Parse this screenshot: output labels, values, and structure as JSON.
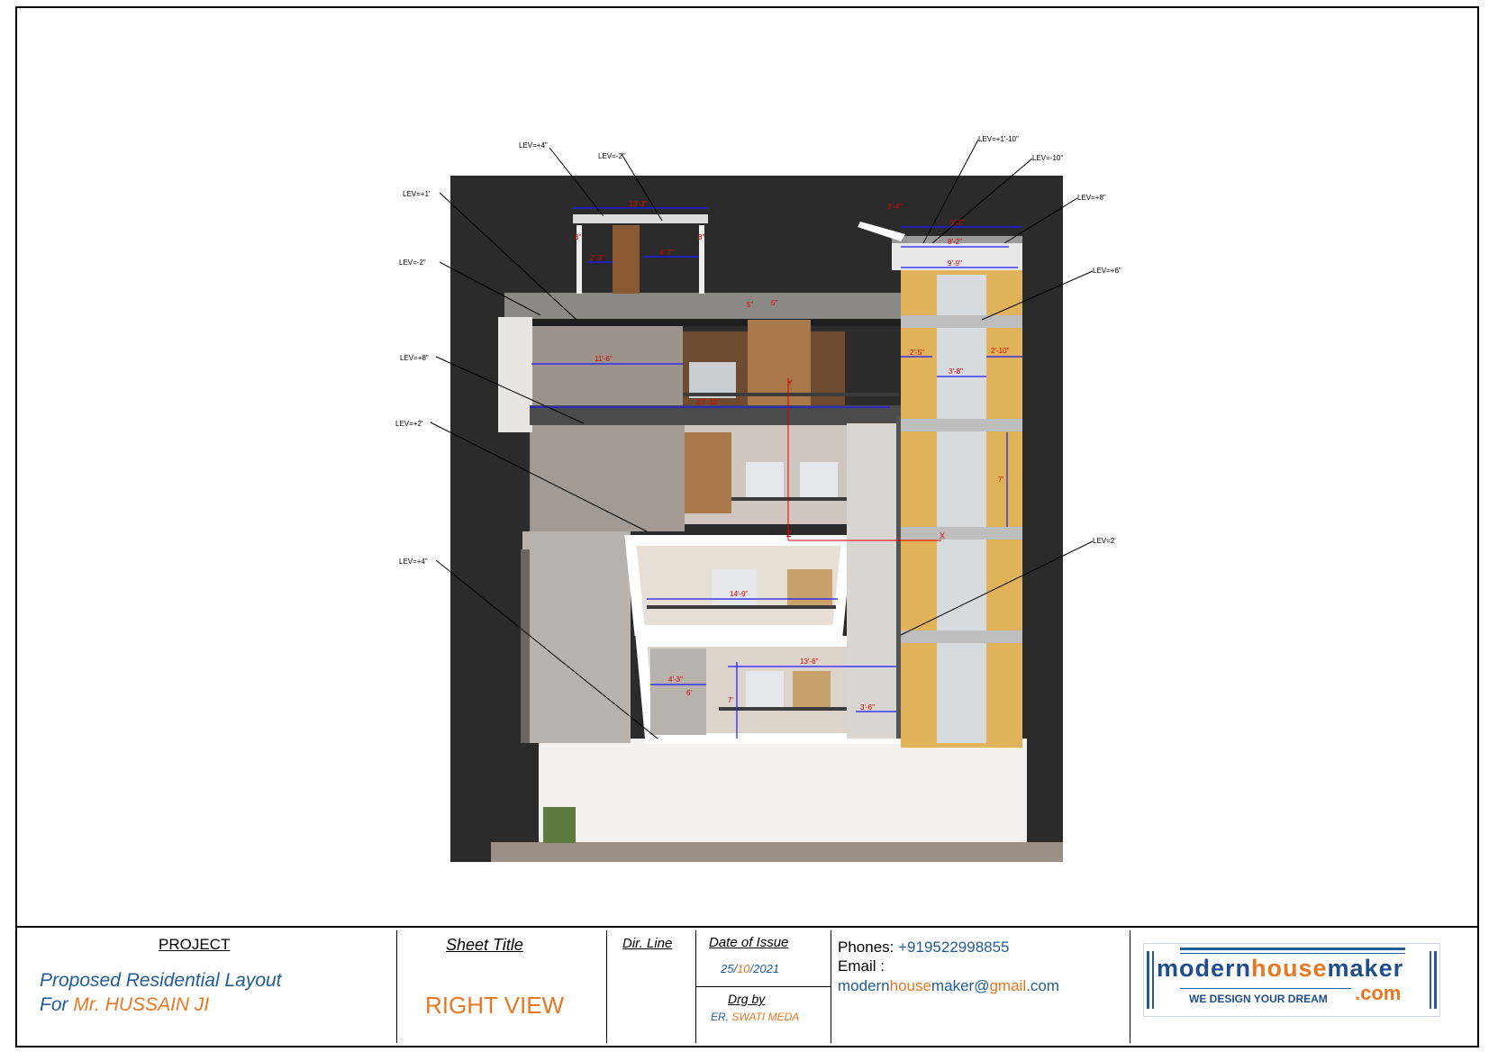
{
  "drawing": {
    "level_labels": [
      "LEV=+4\"",
      "LEV=-2\"",
      "LEV=+1'",
      "LEV=-2\"",
      "LEV=+8\"",
      "LEV=+2'",
      "LEV=+4\"",
      "LEV=+1'-10\"",
      "LEV=-10\"",
      "LEV=+8\"",
      "LEV=+6\"",
      "LEV=2'"
    ],
    "dimension_labels": [
      "10'-3\"",
      "8\"",
      "2'-3\"",
      "4'-7\"",
      "8\"",
      "11'-6\"",
      "27'-10\"",
      "5\"",
      "5\"",
      "3'-4\"",
      "9'-5\"",
      "8'-2\"",
      "9'-9\"",
      "2'-5\"",
      "2'-10\"",
      "3'-8\"",
      "7'",
      "14'-9\"",
      "13'-6\"",
      "4'-3\"",
      "3'-6\"",
      "6'",
      "7'"
    ],
    "axis_labels": [
      "Y",
      "Z",
      "X"
    ],
    "colors": {
      "background": "#2b2b2b",
      "facade": "#c8c0bb",
      "yellow_panel": "#e0b25a",
      "wood": "#8a5a34",
      "stone": "#9c948c",
      "dimension_red": "#e00000",
      "dimension_blue": "#1a1aff"
    }
  },
  "title_block": {
    "project_heading": "PROJECT",
    "project_line1": "Proposed Residential Layout",
    "project_line2_prefix": "For ",
    "project_line2_name": "Mr. HUSSAIN JI",
    "sheet_title_heading": "Sheet Title",
    "sheet_title_value": "RIGHT VIEW",
    "dir_line_heading": "Dir. Line",
    "date_heading": "Date of Issue",
    "date_day": "25/",
    "date_month": "10",
    "date_year": "/2021",
    "drg_by_heading": "Drg by",
    "drg_by_prefix": "ER. ",
    "drg_by_name": "SWATI MEDA",
    "phones_label": "Phones:",
    "phones_value": "+919522998855",
    "email_label": "Email :",
    "email_p1": "modern",
    "email_p2": "house",
    "email_p3": "maker",
    "email_p4": "@",
    "email_p5": "gmail",
    "email_p6": ".com"
  },
  "logo": {
    "word1": "modern",
    "word2": "house",
    "word3": "maker",
    "tagline": "WE DESIGN YOUR DREAM",
    "suffix": ".com"
  }
}
